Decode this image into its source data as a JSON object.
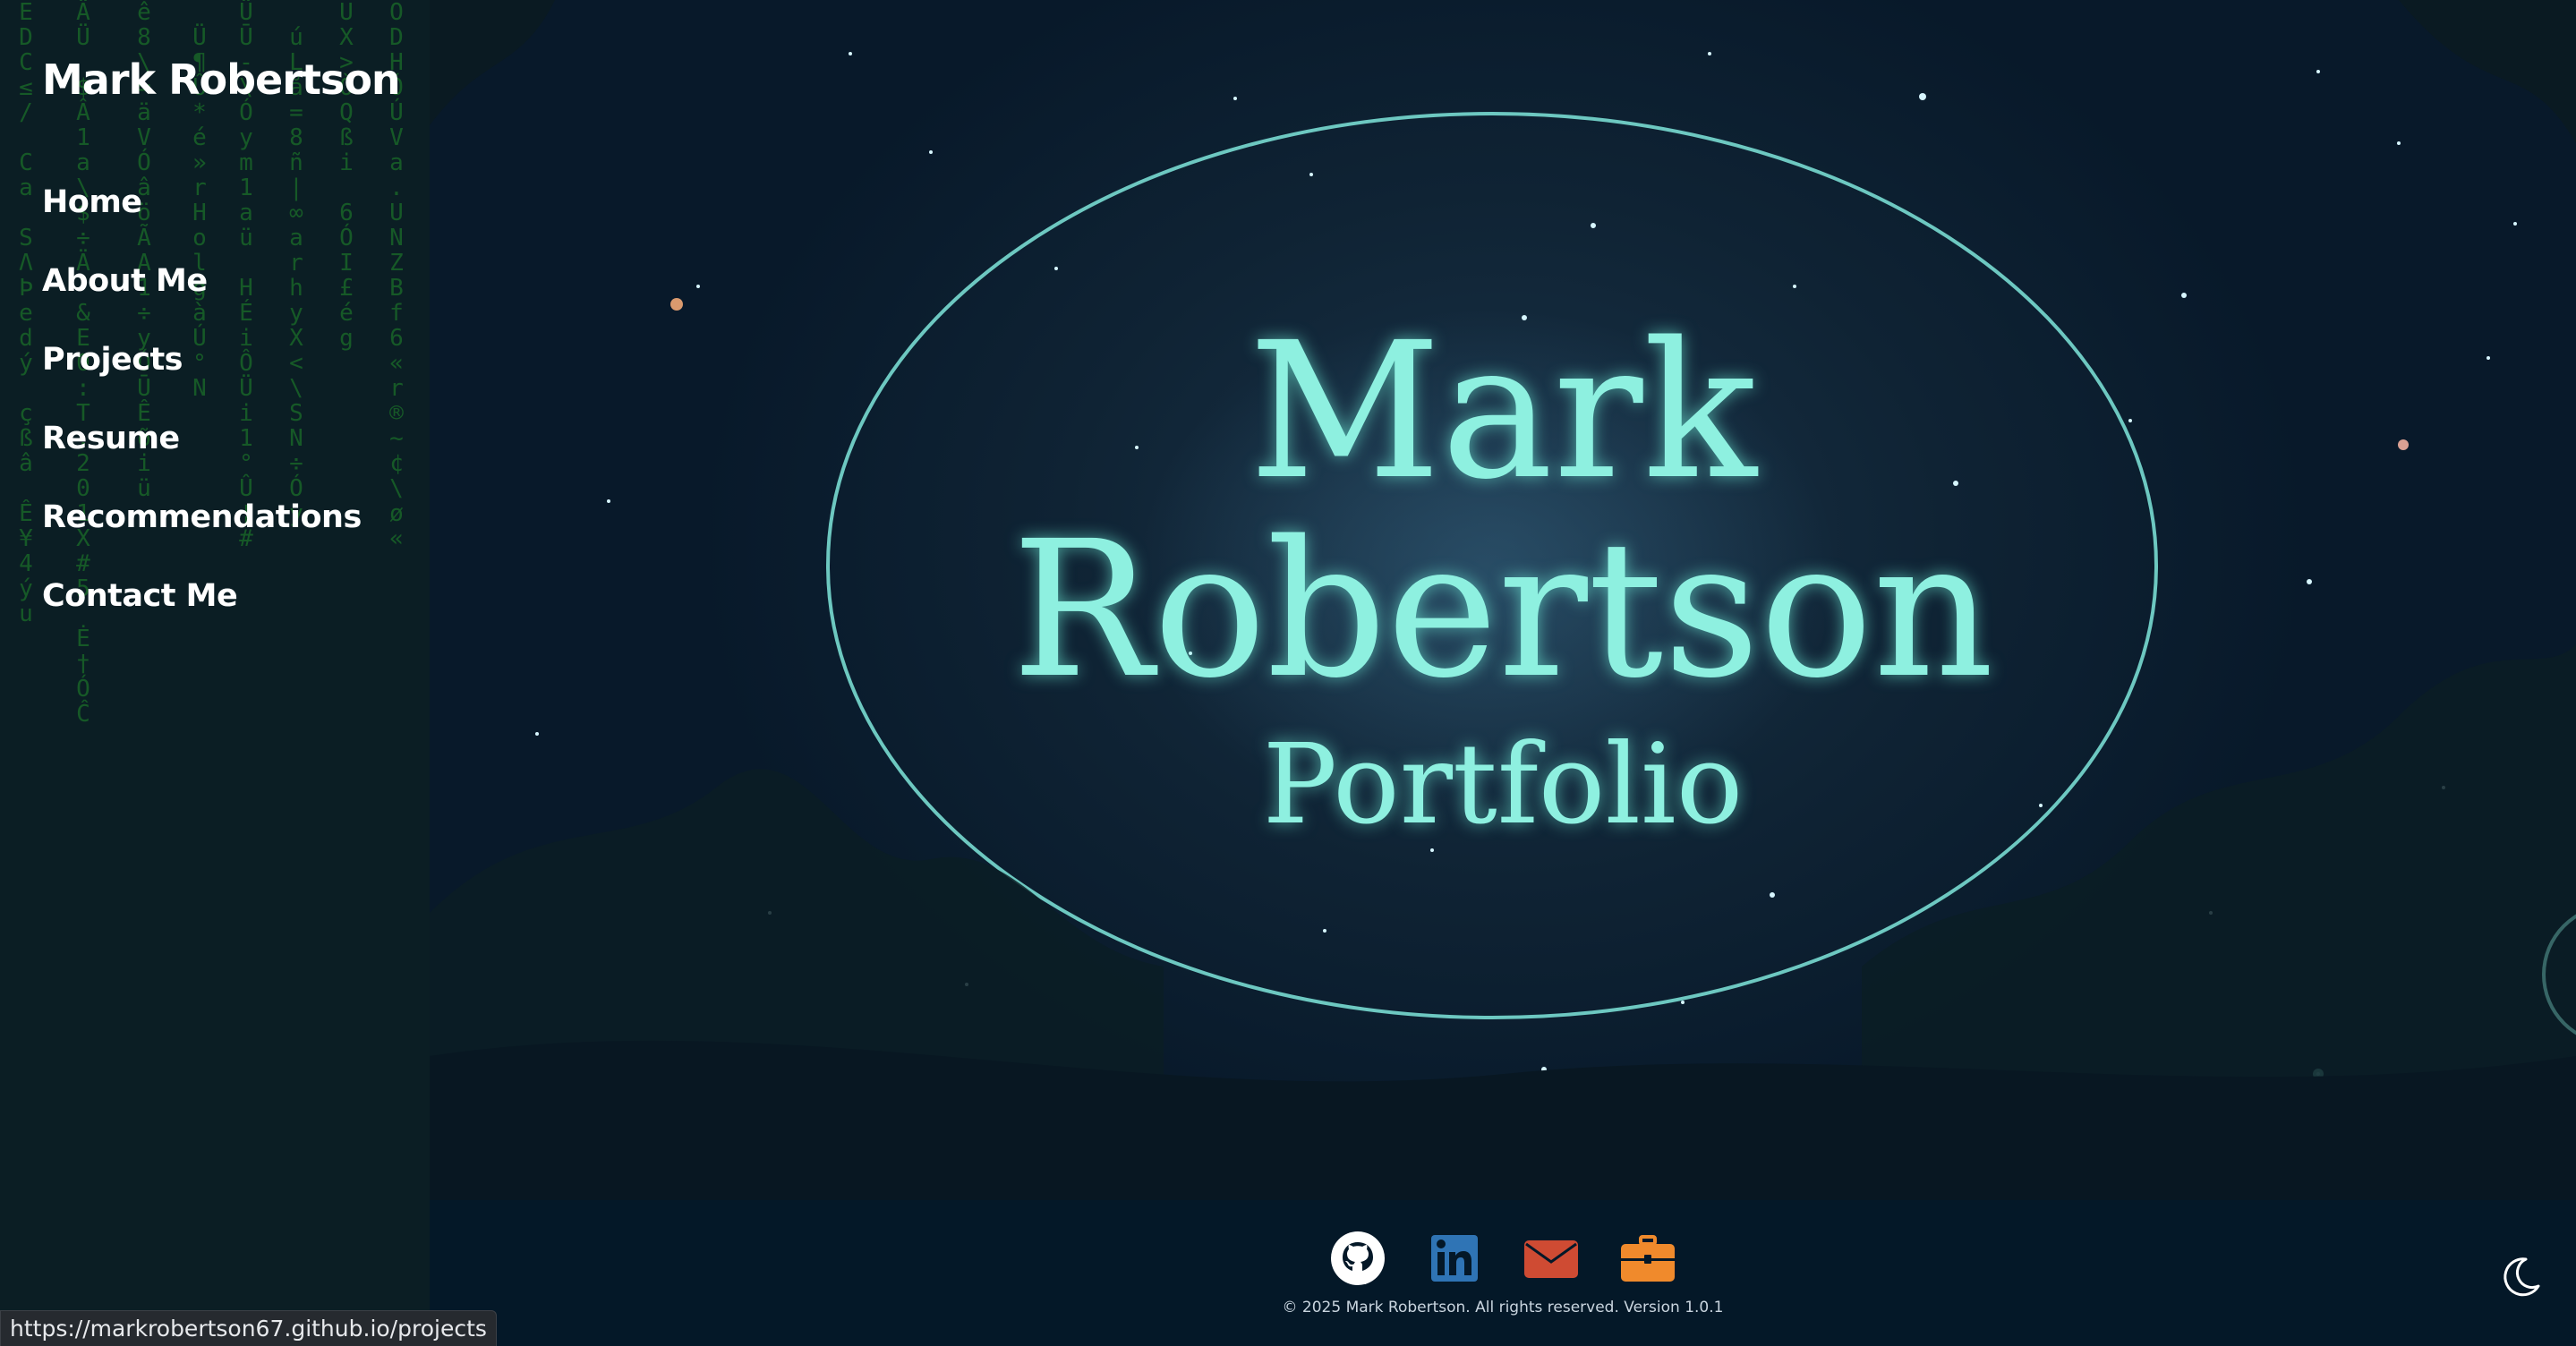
{
  "sidebar": {
    "brand": "Mark Robertson",
    "nav": [
      "Home",
      "About Me",
      "Projects",
      "Resume",
      "Recommendations",
      "Contact Me"
    ]
  },
  "hero": {
    "line1": "Mark",
    "line2": "Robertson",
    "line3": "Portfolio"
  },
  "footer": {
    "icons": [
      "github-icon",
      "linkedin-icon",
      "email-icon",
      "briefcase-icon"
    ],
    "copyright": "© 2025 Mark Robertson. All rights reserved. Version 1.0.1",
    "theme_icon": "moon-icon"
  },
  "status_url": "https://markrobertson67.github.io/projects",
  "colors": {
    "accent": "#8ef0e0",
    "linkedin": "#2f74b5",
    "email": "#cf4b33",
    "briefcase": "#f08a2c",
    "matrix": "#1f8a2a"
  }
}
